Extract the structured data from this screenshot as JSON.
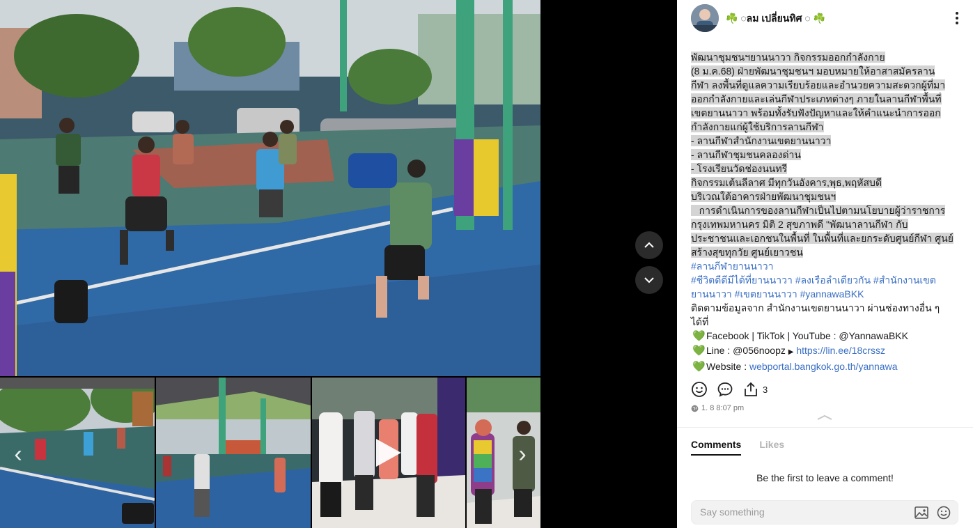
{
  "post": {
    "author": "☘️ ◌ลม เปลี่ยนทิศ ◌ ☘️",
    "caption_lines": [
      "พัฒนาชุมชนฯยานนาวา กิจกรรมออกกำลังกาย",
      " (8 ม.ค.68)  ฝ่ายพัฒนาชุมชนฯ มอบหมายให้อาสาสมัครลาน",
      "กีฬา ลงพื้นที่ดูแลความเรียบร้อยและอำนวยความสะดวกผู้ที่มา",
      "ออกกำลังกายและเล่นกีฬาประเภทต่างๆ ภายในลานกีฬาพื้นที่",
      "เขตยานนาวา พร้อมทั้งรับฟังปัญหาและให้คำแนะนำการออก",
      "กำลังกายแก่ผู้ใช้บริการลานกีฬา",
      "- ลานกีฬาสำนักงานเขตยานนาวา",
      "- ลานกีฬาชุมชนคลองด่าน",
      "- โรงเรียนวัดช่องนนทรี",
      "กิจกรรมเต้นลีลาศ มีทุกวันอังคาร,พุธ,พฤหัสบดี",
      "บริเวณใต้อาคารฝ่ายพัฒนาชุมชนฯ",
      "   การดำเนินการของลานกีฬาเป็นไปตามนโยบายผู้ว่าราชการ",
      "กรุงเทพมหานคร  มิติ 2 สุขภาพดี  \"พัฒนาลานกีฬา กับ",
      "ประชาชนและเอกชนในพื้นที่ ในพื้นที่และยกระดับศูนย์กีฬา ศูนย์",
      "สร้างสุขทุกวัย ศูนย์เยาวชน"
    ],
    "hashtag_lines": [
      "#ลานกีฬายานนาวา",
      "#ชีวิตดีดีมีได้ที่ยานนาวา #ลงเรือลำเดียวกัน #สำนักงานเขต",
      "ยานนาวา #เขตยานนาวา #yannawaBKK"
    ],
    "follow_lines": [
      "ติดตามข้อมูลจาก สำนักงานเขตยานนาวา ผ่านช่องทางอื่น ๆ",
      "ได้ที่"
    ],
    "contacts": {
      "heart": "💚",
      "social": "Facebook | TikTok | YouTube : @YannawaBKK",
      "line_label": "Line : @056noopz",
      "line_arrow": "▶",
      "line_url": "https://lin.ee/18crssz",
      "website_label": "Website : ",
      "website_url": "webportal.bangkok.go.th/yannawa"
    },
    "share_count": "3",
    "timestamp": "1. 8 8:07 pm"
  },
  "media": {
    "prev_icon": "‹",
    "next_icon": "›"
  },
  "comments": {
    "tab_comments": "Comments",
    "tab_likes": "Likes",
    "empty_message": "Be the first to leave a comment!",
    "input_placeholder": "Say something"
  },
  "colors": {
    "hashtag": "#3a6fc4",
    "highlight": "#d4d4d4",
    "heart": "#1fc96a"
  }
}
